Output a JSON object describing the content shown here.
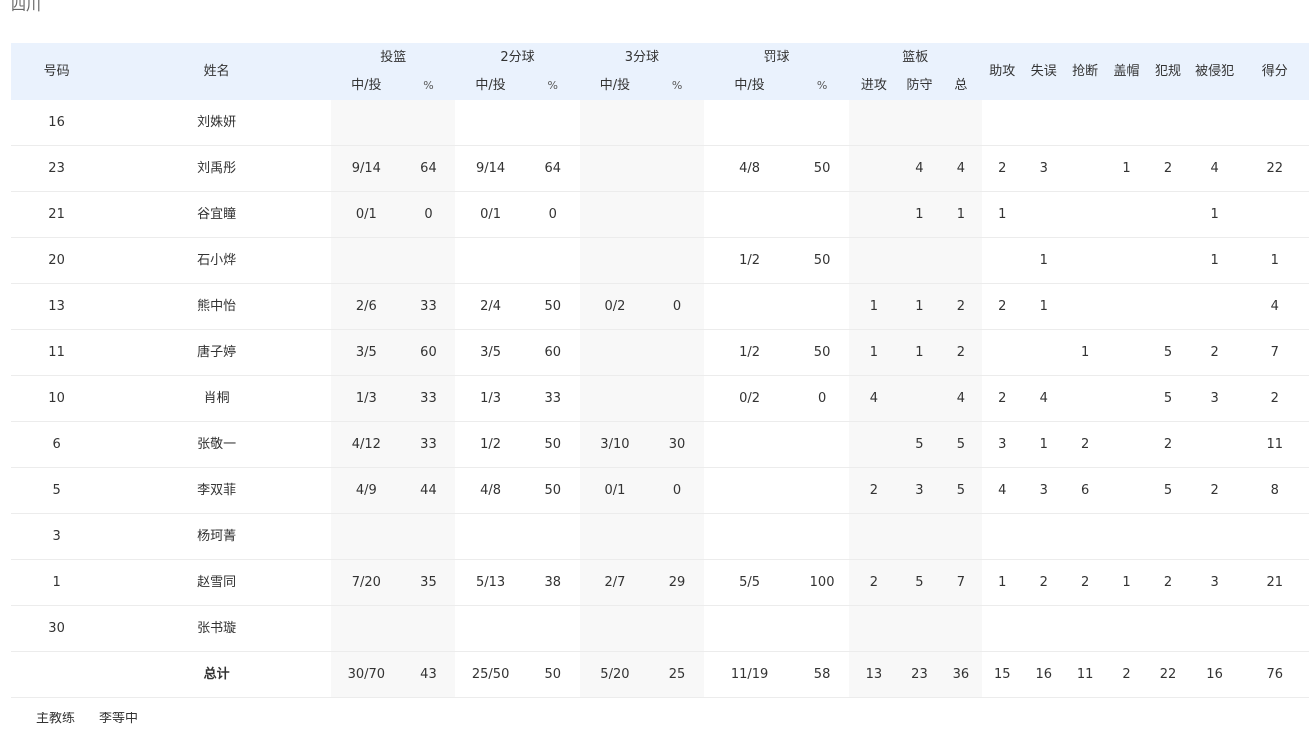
{
  "team": {
    "name": "四川"
  },
  "header": {
    "number": "号码",
    "name": "姓名",
    "groups": {
      "fg": "投篮",
      "two": "2分球",
      "three": "3分球",
      "ft": "罚球",
      "reb": "篮板"
    },
    "sub": {
      "made_att": "中/投",
      "pct": "%",
      "off": "进攻",
      "def": "防守",
      "tot": "总"
    },
    "assists": "助攻",
    "turnovers": "失误",
    "steals": "抢断",
    "blocks": "盖帽",
    "fouls": "犯规",
    "fouled": "被侵犯",
    "points": "得分"
  },
  "players": [
    {
      "num": "16",
      "name": "刘姝妍",
      "fg": "",
      "fgp": "",
      "two": "",
      "twop": "",
      "three": "",
      "threep": "",
      "ft": "",
      "ftp": "",
      "oreb": "",
      "dreb": "",
      "treb": "",
      "ast": "",
      "to": "",
      "stl": "",
      "blk": "",
      "pf": "",
      "fd": "",
      "pts": ""
    },
    {
      "num": "23",
      "name": "刘禹彤",
      "fg": "9/14",
      "fgp": "64",
      "two": "9/14",
      "twop": "64",
      "three": "",
      "threep": "",
      "ft": "4/8",
      "ftp": "50",
      "oreb": "",
      "dreb": "4",
      "treb": "4",
      "ast": "2",
      "to": "3",
      "stl": "",
      "blk": "1",
      "pf": "2",
      "fd": "4",
      "pts": "22"
    },
    {
      "num": "21",
      "name": "谷宜瞳",
      "fg": "0/1",
      "fgp": "0",
      "two": "0/1",
      "twop": "0",
      "three": "",
      "threep": "",
      "ft": "",
      "ftp": "",
      "oreb": "",
      "dreb": "1",
      "treb": "1",
      "ast": "1",
      "to": "",
      "stl": "",
      "blk": "",
      "pf": "",
      "fd": "1",
      "pts": ""
    },
    {
      "num": "20",
      "name": "石小烨",
      "fg": "",
      "fgp": "",
      "two": "",
      "twop": "",
      "three": "",
      "threep": "",
      "ft": "1/2",
      "ftp": "50",
      "oreb": "",
      "dreb": "",
      "treb": "",
      "ast": "",
      "to": "1",
      "stl": "",
      "blk": "",
      "pf": "",
      "fd": "1",
      "pts": "1"
    },
    {
      "num": "13",
      "name": "熊中怡",
      "fg": "2/6",
      "fgp": "33",
      "two": "2/4",
      "twop": "50",
      "three": "0/2",
      "threep": "0",
      "ft": "",
      "ftp": "",
      "oreb": "1",
      "dreb": "1",
      "treb": "2",
      "ast": "2",
      "to": "1",
      "stl": "",
      "blk": "",
      "pf": "",
      "fd": "",
      "pts": "4"
    },
    {
      "num": "11",
      "name": "唐子婷",
      "fg": "3/5",
      "fgp": "60",
      "two": "3/5",
      "twop": "60",
      "three": "",
      "threep": "",
      "ft": "1/2",
      "ftp": "50",
      "oreb": "1",
      "dreb": "1",
      "treb": "2",
      "ast": "",
      "to": "",
      "stl": "1",
      "blk": "",
      "pf": "5",
      "fd": "2",
      "pts": "7"
    },
    {
      "num": "10",
      "name": "肖桐",
      "fg": "1/3",
      "fgp": "33",
      "two": "1/3",
      "twop": "33",
      "three": "",
      "threep": "",
      "ft": "0/2",
      "ftp": "0",
      "oreb": "4",
      "dreb": "",
      "treb": "4",
      "ast": "2",
      "to": "4",
      "stl": "",
      "blk": "",
      "pf": "5",
      "fd": "3",
      "pts": "2"
    },
    {
      "num": "6",
      "name": "张敬一",
      "fg": "4/12",
      "fgp": "33",
      "two": "1/2",
      "twop": "50",
      "three": "3/10",
      "threep": "30",
      "ft": "",
      "ftp": "",
      "oreb": "",
      "dreb": "5",
      "treb": "5",
      "ast": "3",
      "to": "1",
      "stl": "2",
      "blk": "",
      "pf": "2",
      "fd": "",
      "pts": "11"
    },
    {
      "num": "5",
      "name": "李双菲",
      "fg": "4/9",
      "fgp": "44",
      "two": "4/8",
      "twop": "50",
      "three": "0/1",
      "threep": "0",
      "ft": "",
      "ftp": "",
      "oreb": "2",
      "dreb": "3",
      "treb": "5",
      "ast": "4",
      "to": "3",
      "stl": "6",
      "blk": "",
      "pf": "5",
      "fd": "2",
      "pts": "8"
    },
    {
      "num": "3",
      "name": "杨珂菁",
      "fg": "",
      "fgp": "",
      "two": "",
      "twop": "",
      "three": "",
      "threep": "",
      "ft": "",
      "ftp": "",
      "oreb": "",
      "dreb": "",
      "treb": "",
      "ast": "",
      "to": "",
      "stl": "",
      "blk": "",
      "pf": "",
      "fd": "",
      "pts": ""
    },
    {
      "num": "1",
      "name": "赵雪同",
      "fg": "7/20",
      "fgp": "35",
      "two": "5/13",
      "twop": "38",
      "three": "2/7",
      "threep": "29",
      "ft": "5/5",
      "ftp": "100",
      "oreb": "2",
      "dreb": "5",
      "treb": "7",
      "ast": "1",
      "to": "2",
      "stl": "2",
      "blk": "1",
      "pf": "2",
      "fd": "3",
      "pts": "21"
    },
    {
      "num": "30",
      "name": "张书璇",
      "fg": "",
      "fgp": "",
      "two": "",
      "twop": "",
      "three": "",
      "threep": "",
      "ft": "",
      "ftp": "",
      "oreb": "",
      "dreb": "",
      "treb": "",
      "ast": "",
      "to": "",
      "stl": "",
      "blk": "",
      "pf": "",
      "fd": "",
      "pts": ""
    }
  ],
  "total": {
    "num": "",
    "name": "总计",
    "fg": "30/70",
    "fgp": "43",
    "two": "25/50",
    "twop": "50",
    "three": "5/20",
    "threep": "25",
    "ft": "11/19",
    "ftp": "58",
    "oreb": "13",
    "dreb": "23",
    "treb": "36",
    "ast": "15",
    "to": "16",
    "stl": "11",
    "blk": "2",
    "pf": "22",
    "fd": "16",
    "pts": "76"
  },
  "next_row": {
    "label": "主教练",
    "name": "李等中"
  }
}
